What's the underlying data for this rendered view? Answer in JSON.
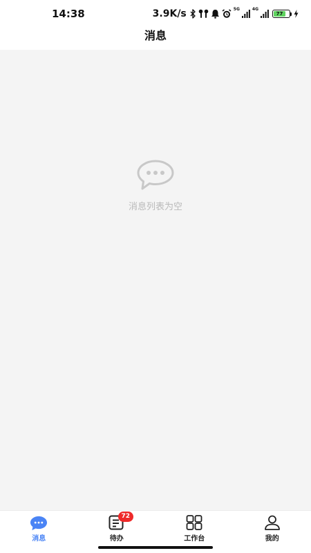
{
  "status_bar": {
    "time": "14:38",
    "net_speed": "3.9K/s",
    "signal_1_label": "5G",
    "signal_2_label": "4G",
    "battery_level": "77",
    "icons": [
      "bluetooth-icon",
      "earbuds-icon",
      "bell-icon",
      "alarm-icon",
      "signal-icon",
      "charging-icon"
    ]
  },
  "header": {
    "title": "消息"
  },
  "empty_state": {
    "icon": "chat-bubble-icon",
    "text": "消息列表为空"
  },
  "tabbar": {
    "tabs": [
      {
        "label": "消息",
        "icon": "message-icon",
        "active": true
      },
      {
        "label": "待办",
        "icon": "todo-icon",
        "badge": "72"
      },
      {
        "label": "工作台",
        "icon": "workbench-grid-icon"
      },
      {
        "label": "我的",
        "icon": "profile-icon"
      }
    ]
  },
  "colors": {
    "accent": "#4a84f5",
    "background": "#f4f4f4",
    "badge": "#ee2a2a",
    "empty_text": "#b9b9b9",
    "battery": "#5fd35f"
  }
}
